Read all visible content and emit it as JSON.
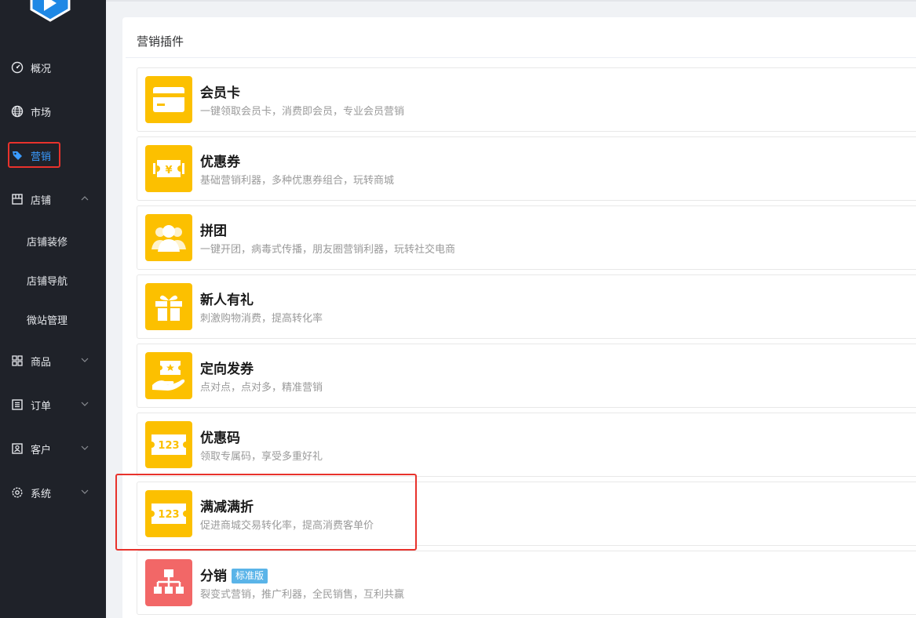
{
  "sidebar": {
    "items": [
      {
        "label": "概况",
        "icon": "dashboard-icon"
      },
      {
        "label": "市场",
        "icon": "globe-icon"
      },
      {
        "label": "营销",
        "icon": "tag-icon",
        "active": true
      },
      {
        "label": "店铺",
        "icon": "store-icon",
        "expanded": true
      },
      {
        "label": "商品",
        "icon": "grid-icon"
      },
      {
        "label": "订单",
        "icon": "list-icon"
      },
      {
        "label": "客户",
        "icon": "customer-icon"
      },
      {
        "label": "系统",
        "icon": "gear-icon"
      }
    ],
    "sub_items": [
      "店铺装修",
      "店铺导航",
      "微站管理"
    ]
  },
  "panel": {
    "title": "营销插件"
  },
  "plugins": [
    {
      "name": "会员卡",
      "desc": "一键领取会员卡，消费即会员，专业会员营销",
      "icon": "member-card-icon"
    },
    {
      "name": "优惠券",
      "desc": "基础营销利器，多种优惠券组合，玩转商城",
      "icon": "coupon-icon"
    },
    {
      "name": "拼团",
      "desc": "一键开团，病毒式传播，朋友圈营销利器，玩转社交电商",
      "icon": "group-buy-icon"
    },
    {
      "name": "新人有礼",
      "desc": "刺激购物消费，提高转化率",
      "icon": "gift-icon"
    },
    {
      "name": "定向发券",
      "desc": "点对点，点对多，精准营销",
      "icon": "targeted-coupon-icon"
    },
    {
      "name": "优惠码",
      "desc": "领取专属码，享受多重好礼",
      "icon": "promo-code-icon",
      "icon_text": "123"
    },
    {
      "name": "满减满折",
      "desc": "促进商城交易转化率，提高消费客单价",
      "icon": "discount-icon",
      "icon_text": "123"
    },
    {
      "name": "分销",
      "badge": "标准版",
      "desc": "裂变式营销，推广利器，全民销售，互利共赢",
      "icon": "distribution-icon"
    }
  ],
  "colors": {
    "sidebar_bg": "#1f2229",
    "active": "#3a9bff",
    "icon_yellow": "#fcc000",
    "icon_red": "#f26767",
    "badge": "#5ab4e8",
    "highlight": "#e8322c"
  }
}
